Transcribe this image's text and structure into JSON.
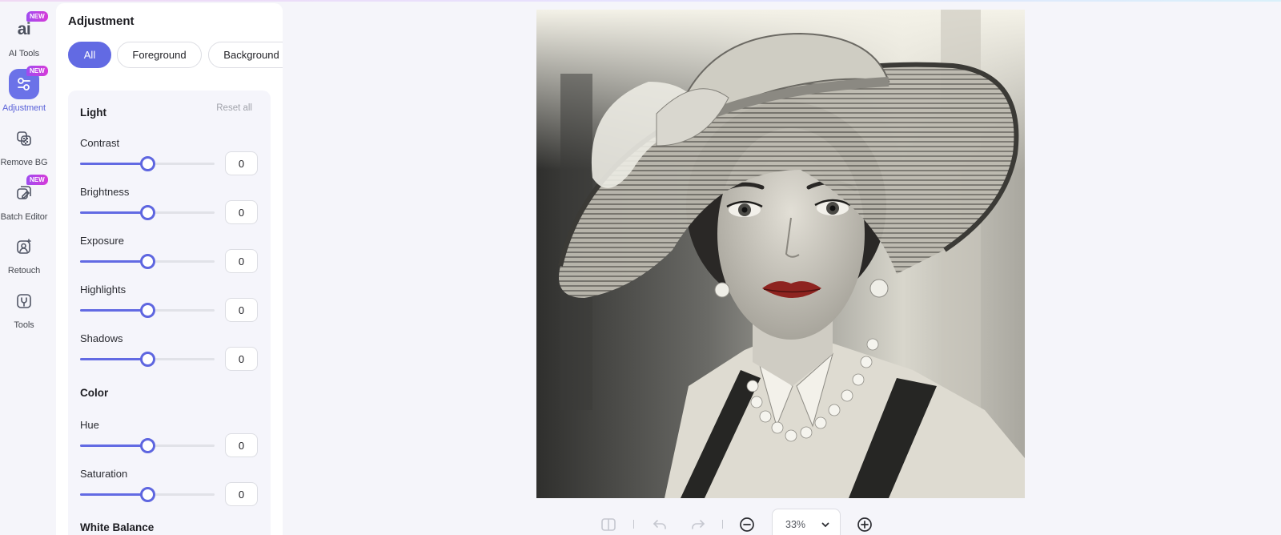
{
  "rail": {
    "items": [
      {
        "label": "AI Tools",
        "badge": "NEW",
        "glyph": "ai"
      },
      {
        "label": "Adjustment",
        "badge": "NEW"
      },
      {
        "label": "Remove BG"
      },
      {
        "label": "Batch Editor",
        "badge": "NEW"
      },
      {
        "label": "Retouch"
      },
      {
        "label": "Tools"
      }
    ]
  },
  "panel": {
    "title": "Adjustment",
    "tabs": [
      "All",
      "Foreground",
      "Background"
    ],
    "active_tab": "All",
    "reset_label": "Reset all",
    "sections": {
      "light": {
        "title": "Light",
        "controls": [
          {
            "label": "Contrast",
            "value": "0",
            "level": 0.5
          },
          {
            "label": "Brightness",
            "value": "0",
            "level": 0.5
          },
          {
            "label": "Exposure",
            "value": "0",
            "level": 0.5
          },
          {
            "label": "Highlights",
            "value": "0",
            "level": 0.5
          },
          {
            "label": "Shadows",
            "value": "0",
            "level": 0.5
          }
        ]
      },
      "color": {
        "title": "Color",
        "controls": [
          {
            "label": "Hue",
            "value": "0",
            "level": 0.5
          },
          {
            "label": "Saturation",
            "value": "0",
            "level": 0.5
          }
        ]
      },
      "white_balance": {
        "title": "White Balance"
      }
    }
  },
  "toolbar": {
    "zoom": "33%",
    "icons": [
      "compare-icon",
      "undo-icon",
      "redo-icon",
      "zoom-out-icon",
      "chevron-down-icon",
      "zoom-in-icon"
    ]
  },
  "colors": {
    "accent": "#626ae3",
    "badge": "#b443e4",
    "panel_bg": "#ffffff",
    "card_bg": "#f5f5fb",
    "lips": "#8e2420"
  }
}
